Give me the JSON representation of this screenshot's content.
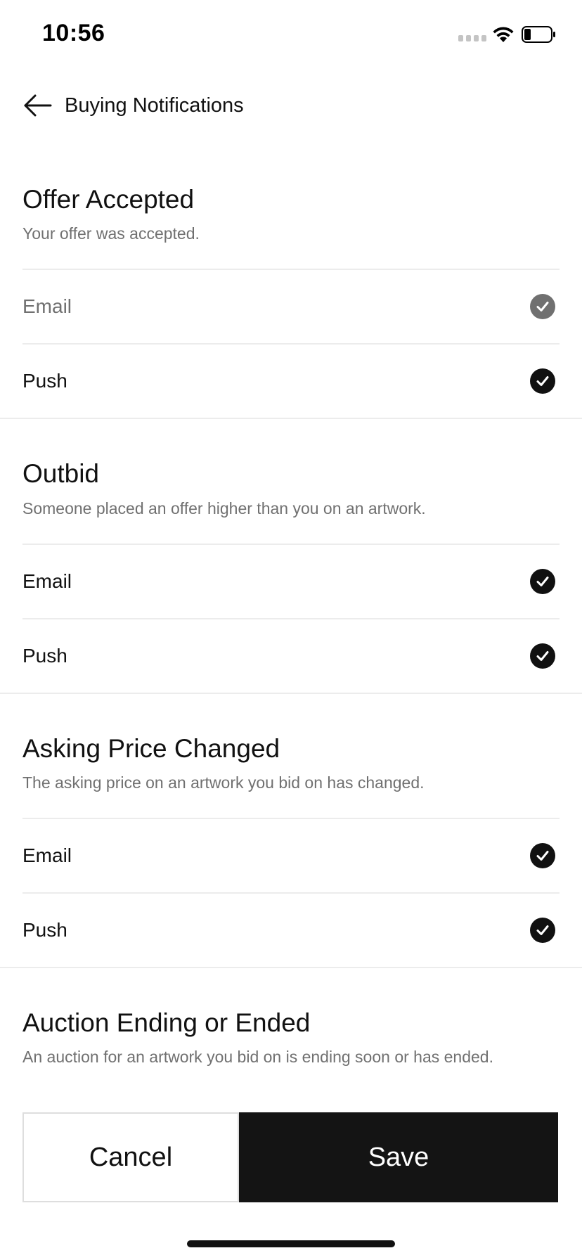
{
  "status_bar": {
    "time": "10:56"
  },
  "header": {
    "title": "Buying Notifications",
    "back_icon": "arrow-left-icon"
  },
  "sections": [
    {
      "title": "Offer Accepted",
      "description": "Your offer was accepted.",
      "options": [
        {
          "label": "Email",
          "checked": true,
          "muted": true
        },
        {
          "label": "Push",
          "checked": true,
          "muted": false
        }
      ]
    },
    {
      "title": "Outbid",
      "description": "Someone placed an offer higher than you on an artwork.",
      "options": [
        {
          "label": "Email",
          "checked": true,
          "muted": false
        },
        {
          "label": "Push",
          "checked": true,
          "muted": false
        }
      ]
    },
    {
      "title": "Asking Price Changed",
      "description": "The asking price on an artwork you bid on has changed.",
      "options": [
        {
          "label": "Email",
          "checked": true,
          "muted": false
        },
        {
          "label": "Push",
          "checked": true,
          "muted": false
        }
      ]
    },
    {
      "title": "Auction Ending or Ended",
      "description": "An auction for an artwork you bid on is ending soon or has ended.",
      "options": []
    }
  ],
  "footer": {
    "cancel_label": "Cancel",
    "save_label": "Save"
  },
  "colors": {
    "primary": "#141414",
    "muted": "#707070",
    "divider": "#ececec"
  },
  "icons": {
    "check": "checkmark-circle-icon",
    "wifi": "wifi-icon",
    "battery": "battery-icon",
    "signal": "signal-icon"
  }
}
